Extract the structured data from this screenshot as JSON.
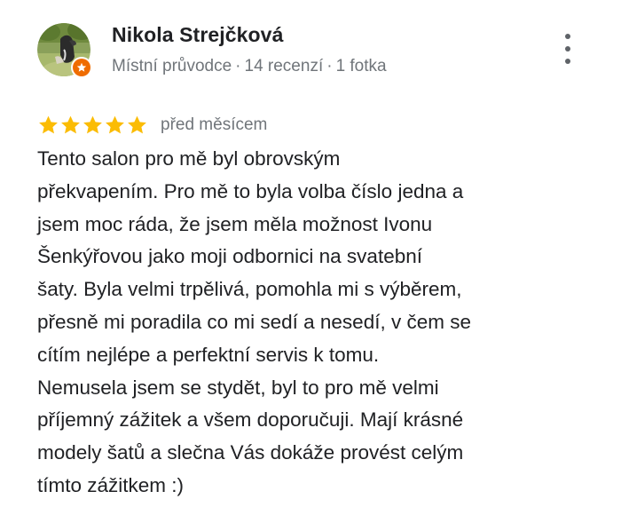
{
  "reviewer": {
    "name": "Nikola Strejčková",
    "role": "Místní průvodce",
    "separator": "·",
    "review_count": "14 recenzí",
    "photo_count": "1 fotka"
  },
  "review": {
    "stars": 5,
    "max_stars": 5,
    "date": "před měsícem",
    "text_lines": [
      "Tento salon pro mě byl obrovským",
      "překvapením. Pro mě to byla volba číslo jedna a",
      "jsem moc ráda, že jsem měla možnost Ivonu",
      "Šenkýřovou jako moji odbornici na svatební",
      "šaty. Byla velmi trpělivá, pomohla mi s výběrem,",
      "přesně mi poradila co mi sedí a nesedí, v čem se",
      "cítím nejlépe a perfektní servis k tomu.",
      "Nemusela jsem se stydět, byl to pro mě velmi",
      "příjemný zážitek a všem doporučuji. Mají krásné",
      "modely šatů a slečna Vás dokáže provést celým",
      "tímto zážitkem :)"
    ]
  },
  "icons": {
    "more": "more-vert-icon",
    "star": "star-icon",
    "badge": "local-guide-badge-icon"
  },
  "colors": {
    "star": "#fbbc04",
    "name_text": "#202124",
    "secondary_text": "#70757a",
    "badge": "#ef6c00",
    "menu_dots": "#5f6368"
  }
}
